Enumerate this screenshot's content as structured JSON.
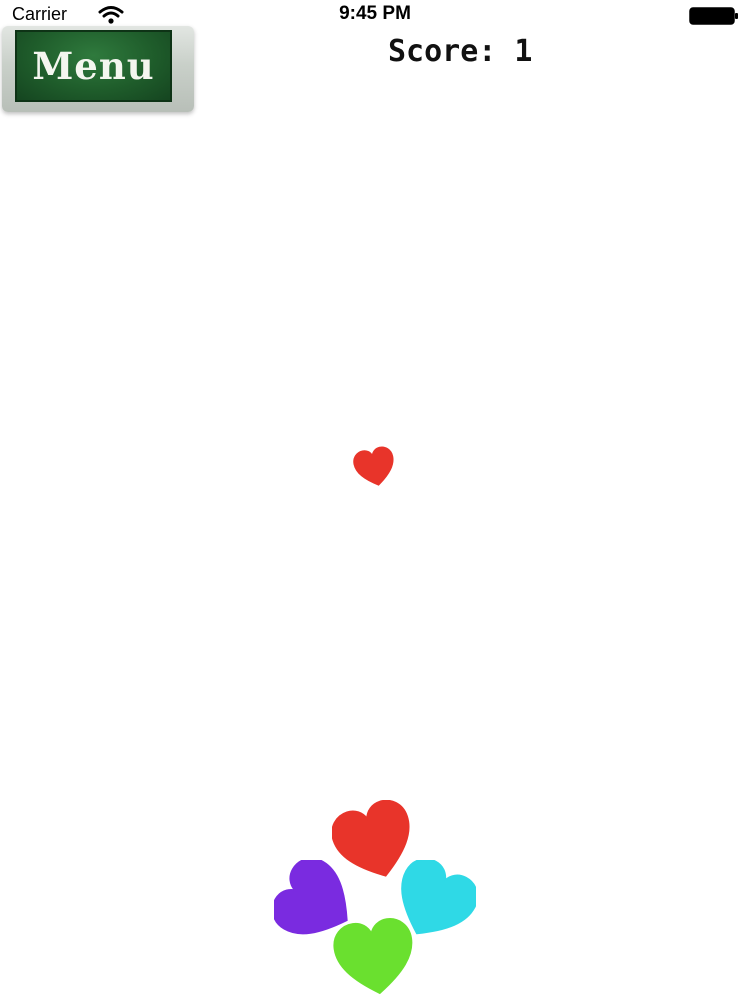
{
  "status_bar": {
    "carrier": "Carrier",
    "time": "9:45 PM",
    "wifi_icon": "wifi-icon",
    "battery_icon": "battery-icon"
  },
  "menu_button": {
    "label": "Menu",
    "color": "#1f5d2b"
  },
  "score": {
    "text": "Score: 1"
  },
  "hearts": {
    "falling": {
      "color": "#e8342a",
      "icon": "heart-icon"
    },
    "top": {
      "color": "#e8342a",
      "icon": "heart-icon"
    },
    "left": {
      "color": "#7a2be0",
      "icon": "heart-icon"
    },
    "right": {
      "color": "#2fd9e6",
      "icon": "heart-icon"
    },
    "bottom": {
      "color": "#6ae02f",
      "icon": "heart-icon"
    }
  }
}
